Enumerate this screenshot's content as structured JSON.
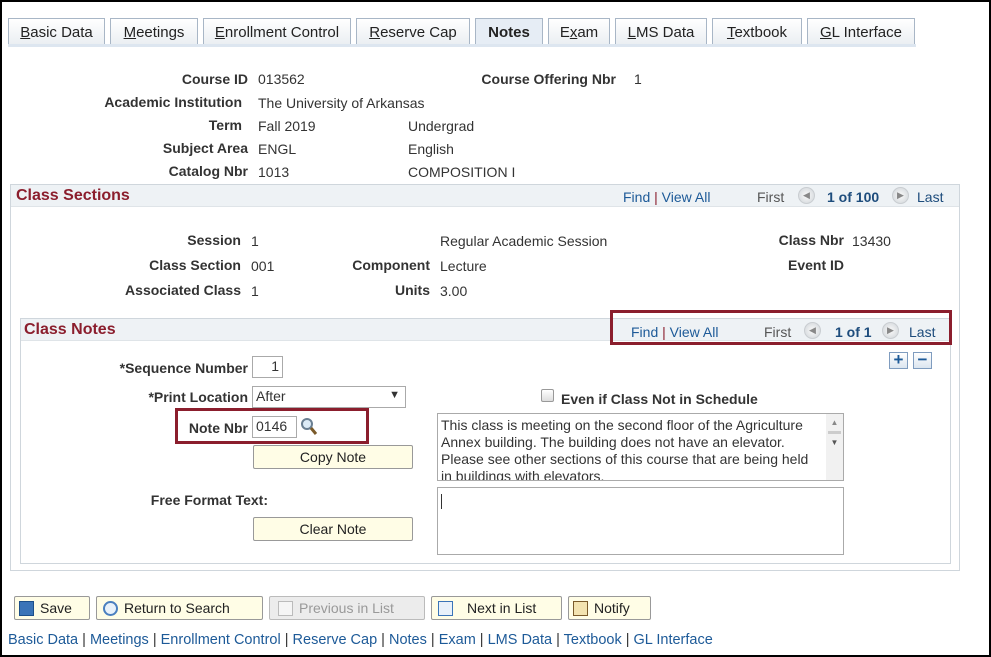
{
  "tabs": [
    {
      "label": "Basic Data",
      "key": "B",
      "rest": "asic Data"
    },
    {
      "label": "Meetings",
      "key": "M",
      "rest": "eetings"
    },
    {
      "label": "Enrollment Control",
      "key": "E",
      "rest": "nrollment Control"
    },
    {
      "label": "Reserve Cap",
      "key": "R",
      "rest": "eserve Cap"
    },
    {
      "label": "Notes",
      "active": true
    },
    {
      "label": "Exam",
      "pre": "E",
      "key": "x",
      "rest": "am"
    },
    {
      "label": "LMS Data",
      "key": "L",
      "rest": "MS Data"
    },
    {
      "label": "Textbook",
      "key": "T",
      "rest": "extbook"
    },
    {
      "label": "GL Interface",
      "key": "G",
      "rest": "L Interface"
    }
  ],
  "header": {
    "course_id_label": "Course ID",
    "course_id": "013562",
    "offering_label": "Course Offering Nbr",
    "offering": "1",
    "institution_label": "Academic Institution",
    "institution": "The University of Arkansas",
    "term_label": "Term",
    "term": "Fall 2019",
    "career": "Undergrad",
    "subject_label": "Subject Area",
    "subject": "ENGL",
    "subject_desc": "English",
    "catalog_label": "Catalog Nbr",
    "catalog": "1013",
    "catalog_desc": "COMPOSITION I"
  },
  "class_sections": {
    "title": "Class Sections",
    "find": "Find",
    "view_all": "View All",
    "first": "First",
    "count": "1 of 100",
    "last": "Last",
    "session_label": "Session",
    "session": "1",
    "session_desc": "Regular Academic Session",
    "class_nbr_label": "Class Nbr",
    "class_nbr": "13430",
    "section_label": "Class Section",
    "section": "001",
    "component_label": "Component",
    "component": "Lecture",
    "event_label": "Event ID",
    "assoc_label": "Associated Class",
    "assoc": "1",
    "units_label": "Units",
    "units": "3.00"
  },
  "class_notes": {
    "title": "Class Notes",
    "find": "Find",
    "view_all": "View All",
    "first": "First",
    "count": "1 of 1",
    "last": "Last",
    "add": "+",
    "remove": "−",
    "seq_label": "*Sequence Number",
    "seq": "1",
    "print_label": "*Print Location",
    "print": "After",
    "even_label": "Even if Class Not in Schedule",
    "note_nbr_label": "Note Nbr",
    "note_nbr": "0146",
    "copy_note": "Copy Note",
    "note_text": "This class is meeting on the second floor of the Agriculture Annex building.  The building does not have an elevator. Please see other sections of this course that are being held in buildings with elevators.",
    "free_label": "Free Format Text:",
    "free_text": "",
    "clear_note": "Clear Note"
  },
  "toolbar": {
    "save": "Save",
    "return": "Return to Search",
    "previous": "Previous in List",
    "next": "Next in List",
    "notify": "Notify"
  },
  "footer_links": [
    "Basic Data",
    "Meetings",
    "Enrollment Control",
    "Reserve Cap",
    "Notes",
    "Exam",
    "LMS Data",
    "Textbook",
    "GL Interface"
  ],
  "colors": {
    "accent": "#8b1e2d",
    "link": "#1d5a98",
    "button": "#fffde6"
  }
}
